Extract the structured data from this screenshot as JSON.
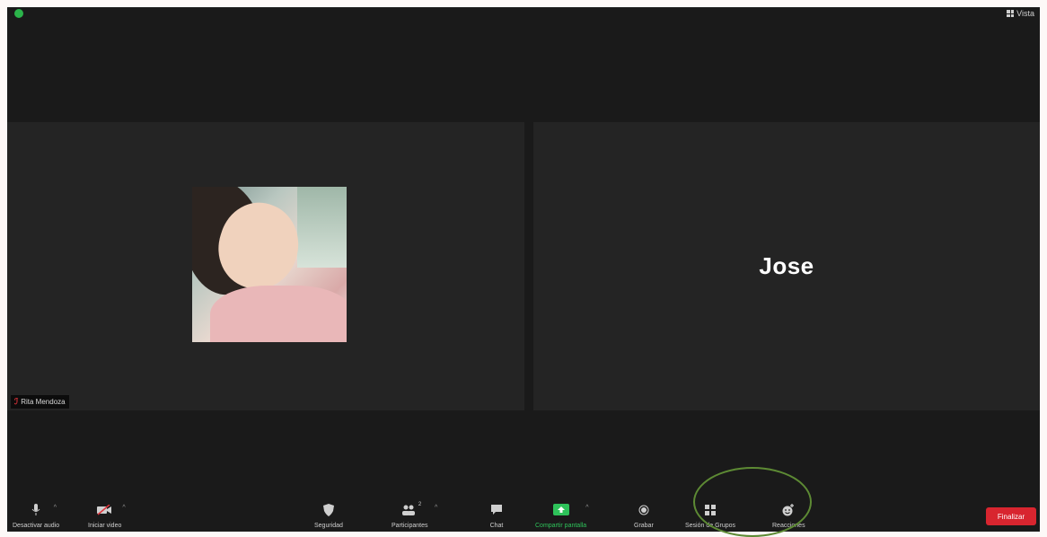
{
  "window": {
    "view_label": "Vista"
  },
  "participants": [
    {
      "name_tag": "Rita Mendoza",
      "has_video": true
    },
    {
      "display_name": "Jose",
      "has_video": false
    }
  ],
  "toolbar": {
    "unmute_label": "Desactivar audio",
    "video_label": "Iniciar video",
    "security_label": "Seguridad",
    "participants_label": "Participantes",
    "participants_count": "2",
    "chat_label": "Chat",
    "share_label": "Compartir pantalla",
    "record_label": "Grabar",
    "breakout_label": "Sesión de Grupos",
    "reactions_label": "Reacciones",
    "end_label": "Finalizar"
  },
  "colors": {
    "share_green": "#2ec25a",
    "end_red": "#d8252f",
    "highlight_ring": "#5d8a34",
    "muted_red": "#e0333b"
  }
}
